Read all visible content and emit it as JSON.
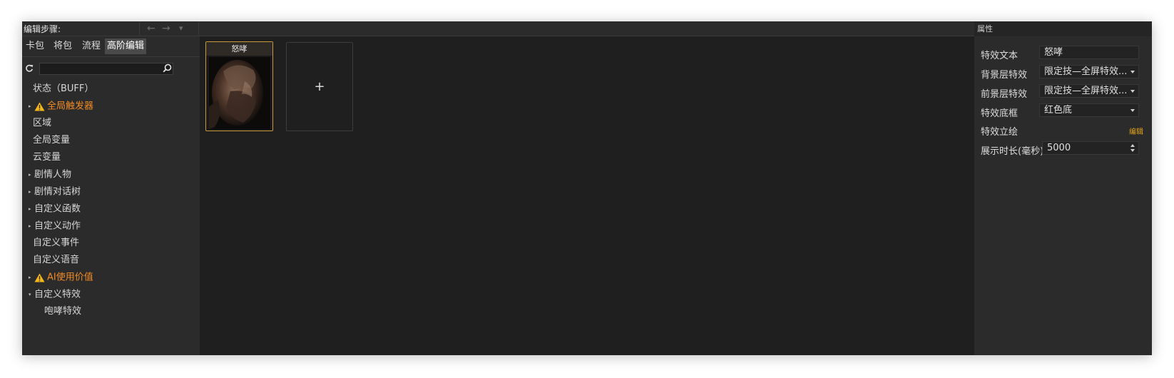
{
  "header": {
    "steps_label": "编辑步骤:",
    "back_icon": "←",
    "forward_icon": "→",
    "dropdown_icon": "▾"
  },
  "tabs": [
    {
      "label": "卡包",
      "active": false
    },
    {
      "label": "将包",
      "active": false
    },
    {
      "label": "流程",
      "active": false
    },
    {
      "label": "高阶编辑",
      "active": true
    }
  ],
  "search": {
    "value": "",
    "placeholder": ""
  },
  "tree": [
    {
      "label": "状态（BUFF）",
      "arrow": "",
      "warn": false
    },
    {
      "label": "全局触发器",
      "arrow": "▸",
      "warn": true
    },
    {
      "label": "区域",
      "arrow": "",
      "warn": false
    },
    {
      "label": "全局变量",
      "arrow": "",
      "warn": false
    },
    {
      "label": "云变量",
      "arrow": "",
      "warn": false
    },
    {
      "label": "剧情人物",
      "arrow": "▸",
      "warn": false
    },
    {
      "label": "剧情对话树",
      "arrow": "▸",
      "warn": false
    },
    {
      "label": "自定义函数",
      "arrow": "▸",
      "warn": false
    },
    {
      "label": "自定义动作",
      "arrow": "▸",
      "warn": false
    },
    {
      "label": "自定义事件",
      "arrow": "",
      "warn": false
    },
    {
      "label": "自定义语音",
      "arrow": "",
      "warn": false
    },
    {
      "label": "AI使用价值",
      "arrow": "▸",
      "warn": true
    },
    {
      "label": "自定义特效",
      "arrow": "▾",
      "warn": false
    },
    {
      "label": "咆哮特效",
      "arrow": "",
      "warn": false,
      "child": true
    }
  ],
  "center": {
    "card_title": "怒哮",
    "add_label": "+"
  },
  "properties": {
    "header": "属性",
    "effect_text_label": "特效文本",
    "effect_text_value": "怒哮",
    "bg_effect_label": "背景层特效",
    "bg_effect_value": "限定技—全屏特效...",
    "fg_effect_label": "前景层特效",
    "fg_effect_value": "限定技—全屏特效...",
    "frame_label": "特效底框",
    "frame_value": "红色底",
    "portrait_label": "特效立绘",
    "portrait_edit": "编辑",
    "duration_label": "展示时长(毫秒)",
    "duration_value": "5000"
  },
  "colors": {
    "accent_warn": "#f08a24",
    "card_border": "#c89a3a",
    "edit_link": "#e2a31a"
  }
}
